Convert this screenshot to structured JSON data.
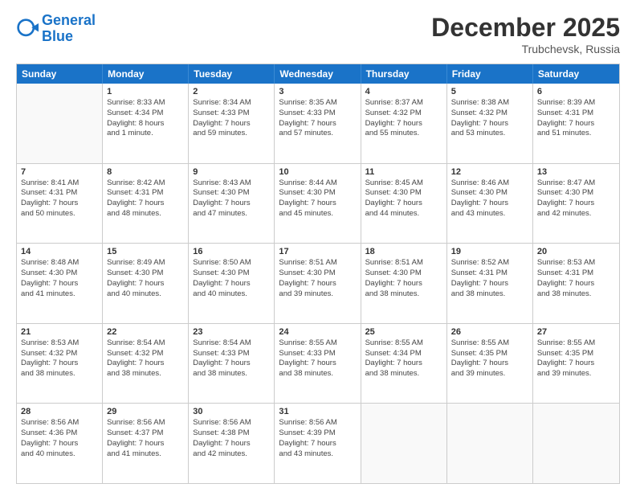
{
  "logo": {
    "line1": "General",
    "line2": "Blue"
  },
  "header": {
    "month": "December 2025",
    "location": "Trubchevsk, Russia"
  },
  "days": [
    "Sunday",
    "Monday",
    "Tuesday",
    "Wednesday",
    "Thursday",
    "Friday",
    "Saturday"
  ],
  "weeks": [
    [
      {
        "day": "",
        "lines": []
      },
      {
        "day": "1",
        "lines": [
          "Sunrise: 8:33 AM",
          "Sunset: 4:34 PM",
          "Daylight: 8 hours",
          "and 1 minute."
        ]
      },
      {
        "day": "2",
        "lines": [
          "Sunrise: 8:34 AM",
          "Sunset: 4:33 PM",
          "Daylight: 7 hours",
          "and 59 minutes."
        ]
      },
      {
        "day": "3",
        "lines": [
          "Sunrise: 8:35 AM",
          "Sunset: 4:33 PM",
          "Daylight: 7 hours",
          "and 57 minutes."
        ]
      },
      {
        "day": "4",
        "lines": [
          "Sunrise: 8:37 AM",
          "Sunset: 4:32 PM",
          "Daylight: 7 hours",
          "and 55 minutes."
        ]
      },
      {
        "day": "5",
        "lines": [
          "Sunrise: 8:38 AM",
          "Sunset: 4:32 PM",
          "Daylight: 7 hours",
          "and 53 minutes."
        ]
      },
      {
        "day": "6",
        "lines": [
          "Sunrise: 8:39 AM",
          "Sunset: 4:31 PM",
          "Daylight: 7 hours",
          "and 51 minutes."
        ]
      }
    ],
    [
      {
        "day": "7",
        "lines": [
          "Sunrise: 8:41 AM",
          "Sunset: 4:31 PM",
          "Daylight: 7 hours",
          "and 50 minutes."
        ]
      },
      {
        "day": "8",
        "lines": [
          "Sunrise: 8:42 AM",
          "Sunset: 4:31 PM",
          "Daylight: 7 hours",
          "and 48 minutes."
        ]
      },
      {
        "day": "9",
        "lines": [
          "Sunrise: 8:43 AM",
          "Sunset: 4:30 PM",
          "Daylight: 7 hours",
          "and 47 minutes."
        ]
      },
      {
        "day": "10",
        "lines": [
          "Sunrise: 8:44 AM",
          "Sunset: 4:30 PM",
          "Daylight: 7 hours",
          "and 45 minutes."
        ]
      },
      {
        "day": "11",
        "lines": [
          "Sunrise: 8:45 AM",
          "Sunset: 4:30 PM",
          "Daylight: 7 hours",
          "and 44 minutes."
        ]
      },
      {
        "day": "12",
        "lines": [
          "Sunrise: 8:46 AM",
          "Sunset: 4:30 PM",
          "Daylight: 7 hours",
          "and 43 minutes."
        ]
      },
      {
        "day": "13",
        "lines": [
          "Sunrise: 8:47 AM",
          "Sunset: 4:30 PM",
          "Daylight: 7 hours",
          "and 42 minutes."
        ]
      }
    ],
    [
      {
        "day": "14",
        "lines": [
          "Sunrise: 8:48 AM",
          "Sunset: 4:30 PM",
          "Daylight: 7 hours",
          "and 41 minutes."
        ]
      },
      {
        "day": "15",
        "lines": [
          "Sunrise: 8:49 AM",
          "Sunset: 4:30 PM",
          "Daylight: 7 hours",
          "and 40 minutes."
        ]
      },
      {
        "day": "16",
        "lines": [
          "Sunrise: 8:50 AM",
          "Sunset: 4:30 PM",
          "Daylight: 7 hours",
          "and 40 minutes."
        ]
      },
      {
        "day": "17",
        "lines": [
          "Sunrise: 8:51 AM",
          "Sunset: 4:30 PM",
          "Daylight: 7 hours",
          "and 39 minutes."
        ]
      },
      {
        "day": "18",
        "lines": [
          "Sunrise: 8:51 AM",
          "Sunset: 4:30 PM",
          "Daylight: 7 hours",
          "and 38 minutes."
        ]
      },
      {
        "day": "19",
        "lines": [
          "Sunrise: 8:52 AM",
          "Sunset: 4:31 PM",
          "Daylight: 7 hours",
          "and 38 minutes."
        ]
      },
      {
        "day": "20",
        "lines": [
          "Sunrise: 8:53 AM",
          "Sunset: 4:31 PM",
          "Daylight: 7 hours",
          "and 38 minutes."
        ]
      }
    ],
    [
      {
        "day": "21",
        "lines": [
          "Sunrise: 8:53 AM",
          "Sunset: 4:32 PM",
          "Daylight: 7 hours",
          "and 38 minutes."
        ]
      },
      {
        "day": "22",
        "lines": [
          "Sunrise: 8:54 AM",
          "Sunset: 4:32 PM",
          "Daylight: 7 hours",
          "and 38 minutes."
        ]
      },
      {
        "day": "23",
        "lines": [
          "Sunrise: 8:54 AM",
          "Sunset: 4:33 PM",
          "Daylight: 7 hours",
          "and 38 minutes."
        ]
      },
      {
        "day": "24",
        "lines": [
          "Sunrise: 8:55 AM",
          "Sunset: 4:33 PM",
          "Daylight: 7 hours",
          "and 38 minutes."
        ]
      },
      {
        "day": "25",
        "lines": [
          "Sunrise: 8:55 AM",
          "Sunset: 4:34 PM",
          "Daylight: 7 hours",
          "and 38 minutes."
        ]
      },
      {
        "day": "26",
        "lines": [
          "Sunrise: 8:55 AM",
          "Sunset: 4:35 PM",
          "Daylight: 7 hours",
          "and 39 minutes."
        ]
      },
      {
        "day": "27",
        "lines": [
          "Sunrise: 8:55 AM",
          "Sunset: 4:35 PM",
          "Daylight: 7 hours",
          "and 39 minutes."
        ]
      }
    ],
    [
      {
        "day": "28",
        "lines": [
          "Sunrise: 8:56 AM",
          "Sunset: 4:36 PM",
          "Daylight: 7 hours",
          "and 40 minutes."
        ]
      },
      {
        "day": "29",
        "lines": [
          "Sunrise: 8:56 AM",
          "Sunset: 4:37 PM",
          "Daylight: 7 hours",
          "and 41 minutes."
        ]
      },
      {
        "day": "30",
        "lines": [
          "Sunrise: 8:56 AM",
          "Sunset: 4:38 PM",
          "Daylight: 7 hours",
          "and 42 minutes."
        ]
      },
      {
        "day": "31",
        "lines": [
          "Sunrise: 8:56 AM",
          "Sunset: 4:39 PM",
          "Daylight: 7 hours",
          "and 43 minutes."
        ]
      },
      {
        "day": "",
        "lines": []
      },
      {
        "day": "",
        "lines": []
      },
      {
        "day": "",
        "lines": []
      }
    ]
  ]
}
